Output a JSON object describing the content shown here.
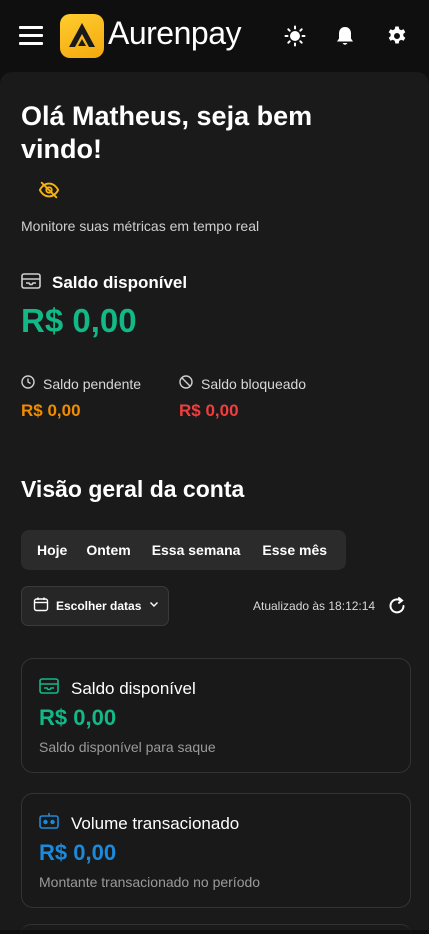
{
  "header": {
    "app_name": "Aurenpay"
  },
  "greeting": {
    "title": "Olá Matheus, seja bem vindo!",
    "subtitle": "Monitore suas métricas em tempo real"
  },
  "balance": {
    "label": "Saldo disponível",
    "value": "R$ 0,00",
    "pending_label": "Saldo pendente",
    "pending_value": "R$ 0,00",
    "blocked_label": "Saldo bloqueado",
    "blocked_value": "R$ 0,00"
  },
  "overview": {
    "title": "Visão geral da conta",
    "tabs": [
      {
        "label": "Hoje"
      },
      {
        "label": "Ontem"
      },
      {
        "label": "Essa semana"
      },
      {
        "label": "Esse mês"
      }
    ],
    "date_button": "Escolher datas",
    "updated_text": "Atualizado às 18:12:14"
  },
  "cards": [
    {
      "title": "Saldo disponível",
      "value": "R$ 0,00",
      "subtitle": "Saldo disponível para saque"
    },
    {
      "title": "Volume transacionado",
      "value": "R$ 0,00",
      "subtitle": "Montante transacionado no período"
    }
  ],
  "colors": {
    "green": "#12b886",
    "orange": "#f08c00",
    "red": "#f03e3e",
    "blue": "#1c8adb",
    "gold": "#f5b312"
  }
}
